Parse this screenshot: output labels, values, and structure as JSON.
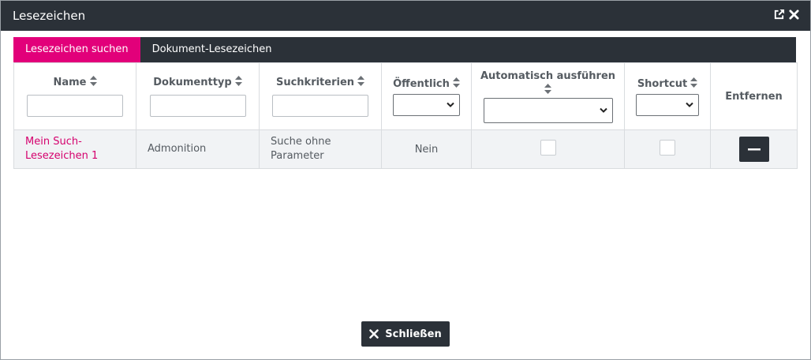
{
  "window": {
    "title": "Lesezeichen",
    "icons": [
      "external-link-icon",
      "close-icon"
    ]
  },
  "tabs": [
    {
      "label": "Lesezeichen suchen",
      "active": true
    },
    {
      "label": "Dokument-Lesezeichen",
      "active": false
    }
  ],
  "table": {
    "columns": [
      {
        "label": "Name",
        "sortable": true,
        "filter": "text"
      },
      {
        "label": "Dokumenttyp",
        "sortable": true,
        "filter": "text"
      },
      {
        "label": "Suchkriterien",
        "sortable": true,
        "filter": "text"
      },
      {
        "label": "Öffentlich",
        "sortable": true,
        "filter": "select"
      },
      {
        "label": "Automatisch ausführen",
        "sortable": true,
        "filter": "select"
      },
      {
        "label": "Shortcut",
        "sortable": true,
        "filter": "select"
      },
      {
        "label": "Entfernen",
        "sortable": false,
        "filter": "none"
      }
    ],
    "rows": [
      {
        "name": "Mein Such-Lesezeichen 1",
        "doctype": "Admonition",
        "criteria": "Suche ohne Parameter",
        "public": "Nein",
        "autorun": false,
        "shortcut": false
      }
    ]
  },
  "footer": {
    "close_label": "Schließen"
  },
  "colors": {
    "dark": "#2b3138",
    "accent": "#e2007a",
    "link": "#d5006d",
    "row_bg": "#f1f3f5"
  }
}
